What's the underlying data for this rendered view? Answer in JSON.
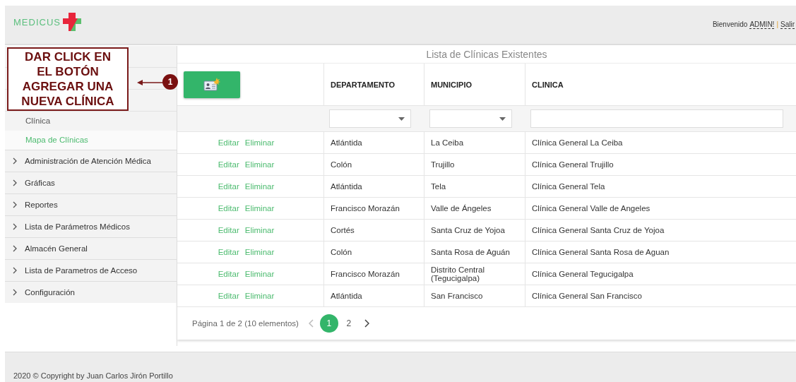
{
  "header": {
    "logo_text": "MEDICUS",
    "welcome": "Bienvenido",
    "user_link": "ADMIN!",
    "separator": "|",
    "logout_link": "Salir"
  },
  "sidebar": {
    "subitems": [
      {
        "label": "Clínica",
        "selected": false
      },
      {
        "label": "Mapa de Clínicas",
        "selected": true
      }
    ],
    "groups": [
      {
        "label": "Administración de Atención Médica",
        "expanded": false
      },
      {
        "label": "Gráficas",
        "expanded": false
      },
      {
        "label": "Reportes",
        "expanded": false
      },
      {
        "label": "Lista de Parámetros Médicos",
        "expanded": false
      },
      {
        "label": "Almacén General",
        "expanded": false
      },
      {
        "label": "Lista de Parametros de Acceso",
        "expanded": false
      },
      {
        "label": "Configuración",
        "expanded": false
      }
    ]
  },
  "callout": {
    "text": "DAR CLICK EN EL BOTÓN AGREGAR UNA NUEVA CLÍNICA",
    "step": "1"
  },
  "table": {
    "title": "Lista de Clínicas Existentes",
    "columns": [
      "DEPARTAMENTO",
      "MUNICIPIO",
      "CLINICA"
    ],
    "filters": [
      {
        "kind": "dropdown"
      },
      {
        "kind": "dropdown"
      },
      {
        "kind": "text"
      }
    ],
    "rows": [
      {
        "edit": "Editar",
        "delete": "Eliminar",
        "cells": [
          "Atlántida",
          "La Ceiba",
          "Clínica General La Ceiba"
        ]
      },
      {
        "edit": "Editar",
        "delete": "Eliminar",
        "cells": [
          "Colón",
          "Trujillo",
          "Clínica General Trujillo"
        ]
      },
      {
        "edit": "Editar",
        "delete": "Eliminar",
        "cells": [
          "Atlántida",
          "Tela",
          "Clínica General Tela"
        ]
      },
      {
        "edit": "Editar",
        "delete": "Eliminar",
        "cells": [
          "Francisco Morazán",
          "Valle de Ángeles",
          "Clínica General Valle de Angeles"
        ]
      },
      {
        "edit": "Editar",
        "delete": "Eliminar",
        "cells": [
          "Cortés",
          "Santa Cruz de Yojoa",
          "Clínica General Santa Cruz de Yojoa"
        ]
      },
      {
        "edit": "Editar",
        "delete": "Eliminar",
        "cells": [
          "Colón",
          "Santa Rosa de Aguán",
          "Clínica General Santa Rosa de Aguan"
        ]
      },
      {
        "edit": "Editar",
        "delete": "Eliminar",
        "cells": [
          "Francisco Morazán",
          "Distrito Central (Tegucigalpa)",
          "Clínica General Tegucigalpa"
        ]
      },
      {
        "edit": "Editar",
        "delete": "Eliminar",
        "cells": [
          "Atlántida",
          "San Francisco",
          "Clínica General San Francisco"
        ]
      }
    ],
    "pager": {
      "summary": "Página 1 de 2 (10 elementos)",
      "pages": [
        {
          "label": "1",
          "selected": true
        },
        {
          "label": "2",
          "selected": false
        }
      ]
    }
  },
  "footer": {
    "text": "2020 © Copyright by Juan Carlos Jirón Portillo"
  }
}
